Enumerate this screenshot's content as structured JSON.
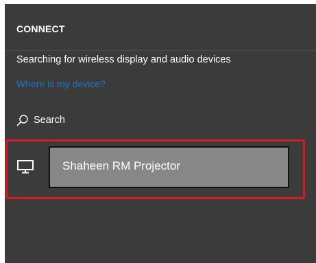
{
  "panel": {
    "title": "CONNECT",
    "status_text": "Searching for wireless display and audio devices",
    "help_link": "Where is my device?"
  },
  "search": {
    "label": "Search",
    "icon": "search-icon"
  },
  "devices": [
    {
      "name": "Shaheen RM Projector",
      "icon": "monitor-icon",
      "highlighted": true
    }
  ],
  "colors": {
    "panel_background": "#3b3b3b",
    "link": "#1e74c9",
    "highlight_border": "#d71920",
    "name_box": "#878787"
  }
}
